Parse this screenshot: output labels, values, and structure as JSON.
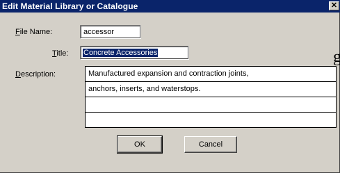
{
  "window": {
    "title": "Edit Material Library or Catalogue",
    "close_glyph": "✕"
  },
  "labels": {
    "file_name_accel": "F",
    "file_name_rest": "ile Name:",
    "title_accel": "T",
    "title_rest": "itle:",
    "description_accel": "D",
    "description_rest": "escription:"
  },
  "fields": {
    "file_name": "accessor",
    "title": "Concrete Accessories"
  },
  "description_lines": [
    "Manufactured expansion and contraction joints,",
    "anchors, inserts, and waterstops.",
    "",
    ""
  ],
  "buttons": {
    "ok": "OK",
    "cancel": "Cancel"
  },
  "background_glyph": "g",
  "colors": {
    "titlebar": "#0a246a",
    "dialog_face": "#d4d0c8",
    "selection": "#0a246a"
  }
}
